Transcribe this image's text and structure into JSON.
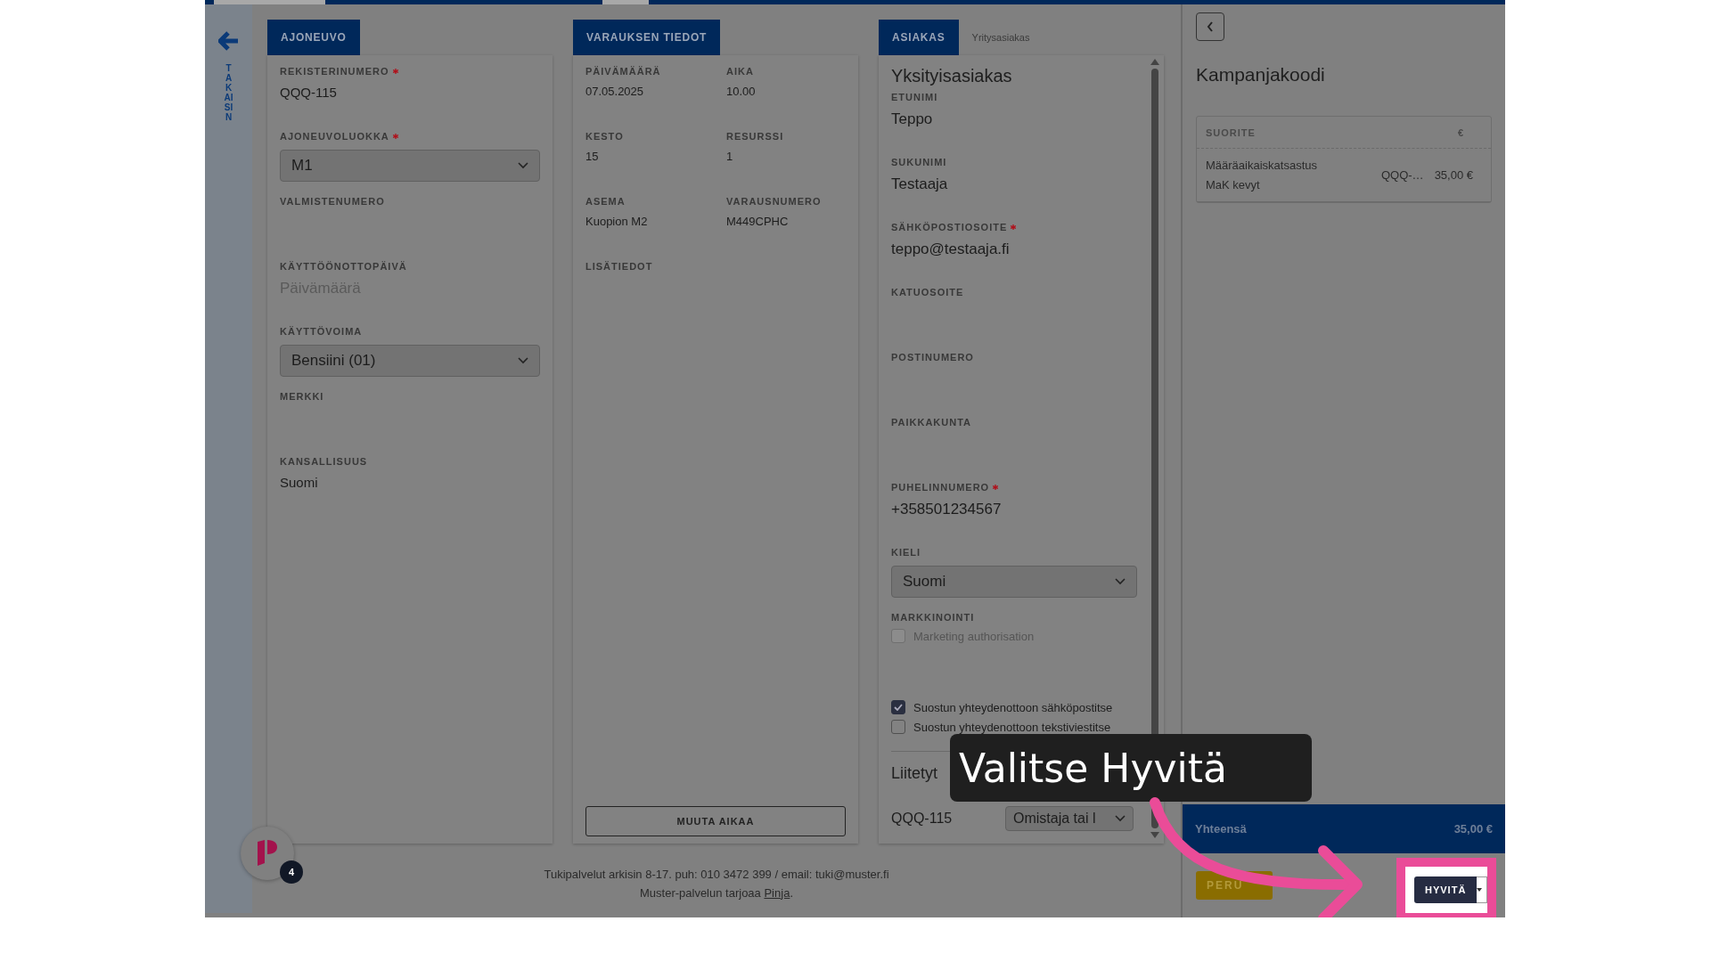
{
  "sidebar": {
    "back_label": "TAKAISIN"
  },
  "vehicle": {
    "tab": "AJONEUVO",
    "fields": [
      {
        "kind": "text",
        "label": "REKISTERINUMERO",
        "required": true,
        "value": "QQQ-115"
      },
      {
        "kind": "select",
        "label": "AJONEUVOLUOKKA",
        "required": true,
        "value": "M1"
      },
      {
        "kind": "text",
        "label": "VALMISTENUMERO",
        "required": false
      },
      {
        "kind": "date",
        "label": "KÄYTTÖÖNOTTOPÄIVÄ",
        "required": false,
        "placeholder": "Päivämäärä"
      },
      {
        "kind": "select",
        "label": "KÄYTTÖVOIMA",
        "required": false,
        "value": "Bensiini (01)"
      },
      {
        "kind": "text",
        "label": "MERKKI",
        "required": false
      },
      {
        "kind": "text",
        "label": "KANSALLISUUS",
        "required": false,
        "value": "Suomi"
      }
    ]
  },
  "booking": {
    "tab": "VARAUKSEN TIEDOT",
    "fields": [
      {
        "label": "PÄIVÄMÄÄRÄ",
        "value": "07.05.2025"
      },
      {
        "label": "AIKA",
        "value": "10.00"
      },
      {
        "label": "KESTO",
        "value": "15"
      },
      {
        "label": "RESURSSI",
        "value": "1"
      },
      {
        "label": "ASEMA",
        "value": "Kuopion M2"
      },
      {
        "label": "VARAUSNUMERO",
        "value": "M449CPHC"
      },
      {
        "label": "LISÄTIEDOT"
      }
    ],
    "button": "MUUTA AIKAA"
  },
  "customer": {
    "tabs": [
      {
        "label": "ASIAKAS",
        "selected": true
      },
      {
        "label": "Yritysasiakas",
        "selected": false
      }
    ],
    "heading": "Yksityisasiakas",
    "fields": [
      {
        "kind": "text",
        "label": "ETUNIMI",
        "required": false,
        "value": "Teppo"
      },
      {
        "kind": "text",
        "label": "SUKUNIMI",
        "required": false,
        "value": "Testaaja"
      },
      {
        "kind": "text",
        "label": "SÄHKÖPOSTIOSOITE",
        "required": true,
        "value": "teppo@testaaja.fi"
      },
      {
        "kind": "text",
        "label": "KATUOSOITE",
        "required": false
      },
      {
        "kind": "text",
        "label": "POSTINUMERO",
        "required": false
      },
      {
        "kind": "text",
        "label": "PAIKKAKUNTA",
        "required": false
      },
      {
        "kind": "text",
        "label": "PUHELINNUMERO",
        "required": true,
        "value": "+358501234567"
      },
      {
        "kind": "select",
        "label": "KIELI",
        "required": false,
        "value": "Suomi"
      }
    ],
    "marketing": {
      "label": "MARKKINOINTI",
      "options": [
        {
          "label": "Marketing authorisation",
          "checked": false,
          "disabled": true
        },
        {
          "label": "Suostun yhteydenottoon sähköpostitse",
          "checked": true,
          "disabled": false
        },
        {
          "label": "Suostun yhteydenottoon tekstiviestitse",
          "checked": false,
          "disabled": false
        }
      ]
    },
    "linked": {
      "heading": "Liitetyt",
      "rows": [
        {
          "plate": "QQQ-115",
          "role": "Omistaja tai l"
        }
      ]
    }
  },
  "summary": {
    "heading": "Kampanjakoodi",
    "columns": [
      "SUORITE",
      "€"
    ],
    "rows": [
      {
        "name": [
          "Määräaikaiskatsastus",
          "MaK kevyt"
        ],
        "plate": "QQQ-…",
        "price": "35,00 €"
      }
    ],
    "total_label": "Yhteensä",
    "total": "35,00 €",
    "cancel": "PERU",
    "credit": "HYVITÄ"
  },
  "footer": {
    "line": "Tukipalvelut arkisin 8-17. puh: 010 3472 399 / email: tuki@muster.fi",
    "credit_prefix": "Muster-palvelun tarjoaa ",
    "credit_link": "Pinja",
    "credit_suffix": "."
  },
  "chat": {
    "badge": "4"
  },
  "callout": {
    "text": "Valitse Hyvitä"
  }
}
